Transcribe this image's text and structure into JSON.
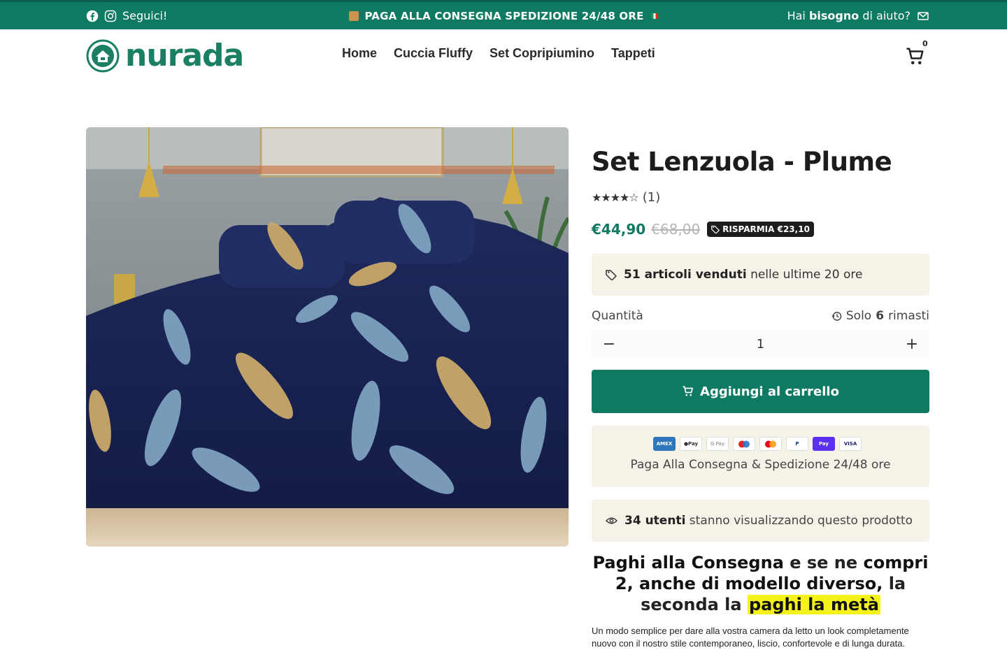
{
  "announcement": {
    "follow_label": "Seguici!",
    "center_text": "PAGA ALLA CONSEGNA SPEDIZIONE 24/48 ORE",
    "help_prefix": "Hai",
    "help_bold": "bisogno",
    "help_suffix": "di aiuto?"
  },
  "header": {
    "logo_text": "nurada",
    "nav": [
      "Home",
      "Cuccia Fluffy",
      "Set Copripiumino",
      "Tappeti"
    ],
    "cart_count": "0"
  },
  "product": {
    "title": "Set Lenzuola - Plume",
    "rating": 4,
    "rating_stars": "★★★★☆",
    "review_count": "(1)",
    "price": "€44,90",
    "compare_price": "€68,00",
    "save_label": "RISPARMIA €23,10",
    "sold_bold": "51 articoli venduti",
    "sold_rest": "nelle ultime 20 ore",
    "quantity_label": "Quantità",
    "stock_prefix": "Solo",
    "stock_count": "6",
    "stock_suffix": "rimasti",
    "quantity_value": "1",
    "add_to_cart": "Aggiungi al carrello",
    "payment_methods": [
      "AMEX",
      "Apple Pay",
      "G Pay",
      "Maestro",
      "Mastercard",
      "PayPal",
      "Shop Pay",
      "VISA"
    ],
    "payment_text": "Paga Alla Consegna & Spedizione 24/48 ore",
    "viewers_bold": "34 utenti",
    "viewers_rest": "stanno visualizzando questo prodotto",
    "promo_a": "Paghi alla Consegna",
    "promo_b": "e se ne",
    "promo_c": "compri 2, anche di modello diverso,",
    "promo_d": "la seconda la",
    "promo_highlight": "paghi la metà",
    "description": "Un modo semplice per dare alla vostra camera da letto un look completamente nuovo con il nostro stile contemporaneo, liscio, confortevole e di lunga durata."
  },
  "colors": {
    "brand_green": "#0f7a62",
    "panel_beige": "#f5f2e8",
    "highlight_yellow": "#f5f21a"
  }
}
